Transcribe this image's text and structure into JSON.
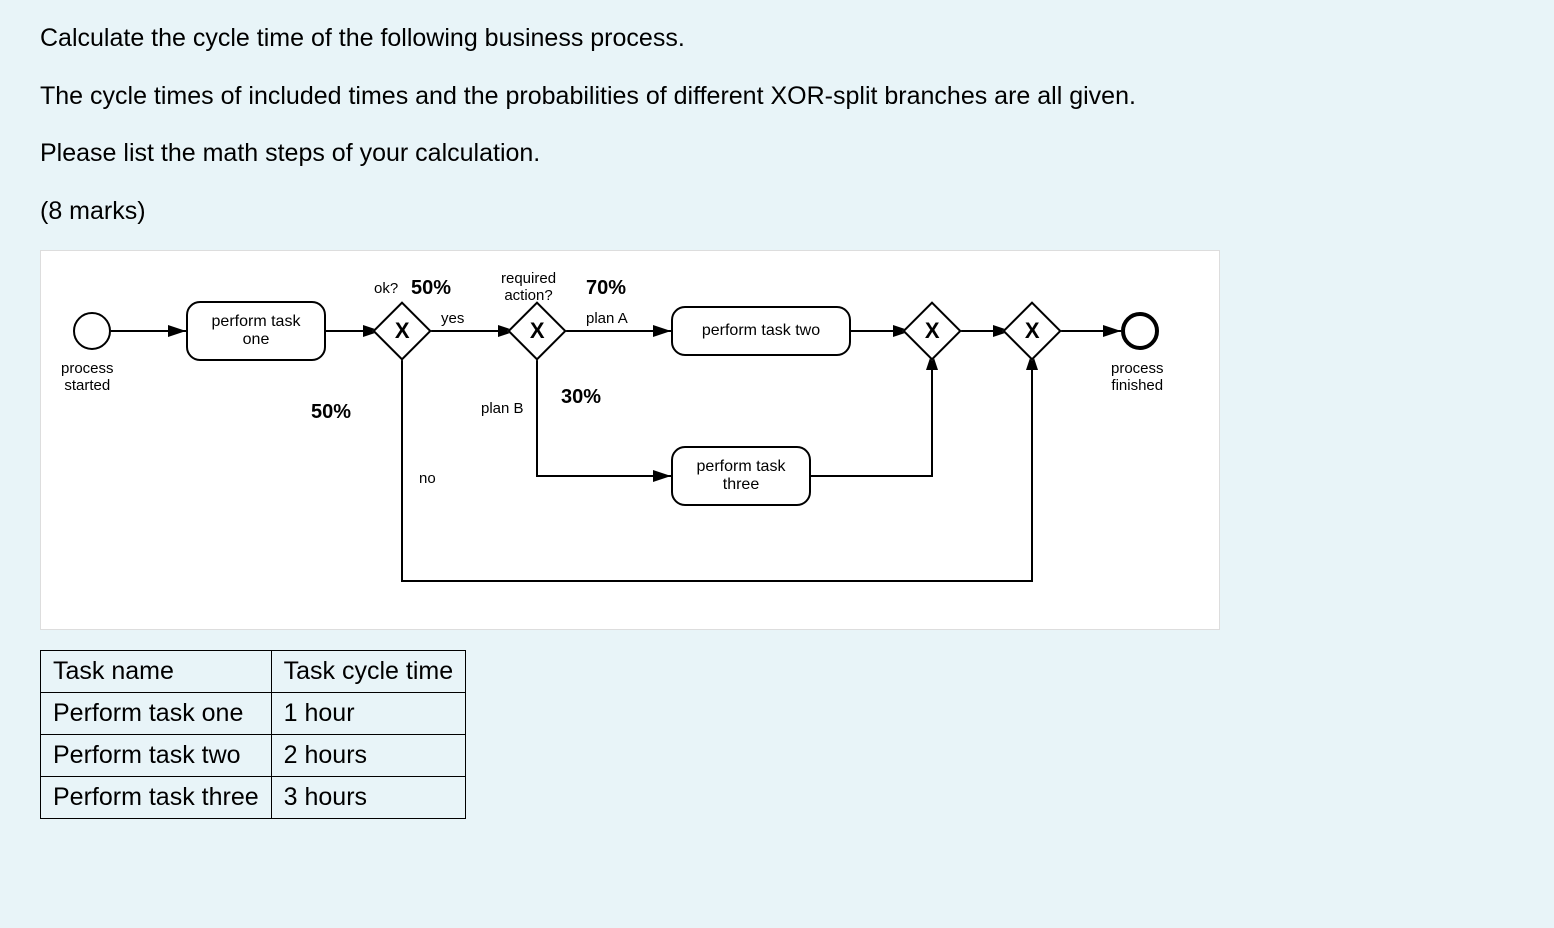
{
  "question": {
    "line1": "Calculate the cycle time of the following business process.",
    "line2": "The cycle times of included times and the probabilities of different XOR-split branches are all given.",
    "line3": "Please list the math steps of your calculation.",
    "marks": "(8 marks)"
  },
  "diagram": {
    "startLabel": "process\nstarted",
    "endLabel": "process\nfinished",
    "task1": "perform task\none",
    "task2": "perform task two",
    "task3": "perform task\nthree",
    "gw1Label": "ok?",
    "gw1Yes": "yes",
    "gw1No": "no",
    "gw1YesPct": "50%",
    "gw1NoPct": "50%",
    "gw2Label": "required\naction?",
    "gw2PlanA": "plan A",
    "gw2PlanB": "plan B",
    "gw2APct": "70%",
    "gw2BPct": "30%"
  },
  "table": {
    "header": {
      "name": "Task name",
      "time": "Task cycle time"
    },
    "rows": [
      {
        "name": "Perform task one",
        "time": "1 hour"
      },
      {
        "name": "Perform task two",
        "time": "2 hours"
      },
      {
        "name": "Perform task three",
        "time": "3 hours"
      }
    ]
  }
}
